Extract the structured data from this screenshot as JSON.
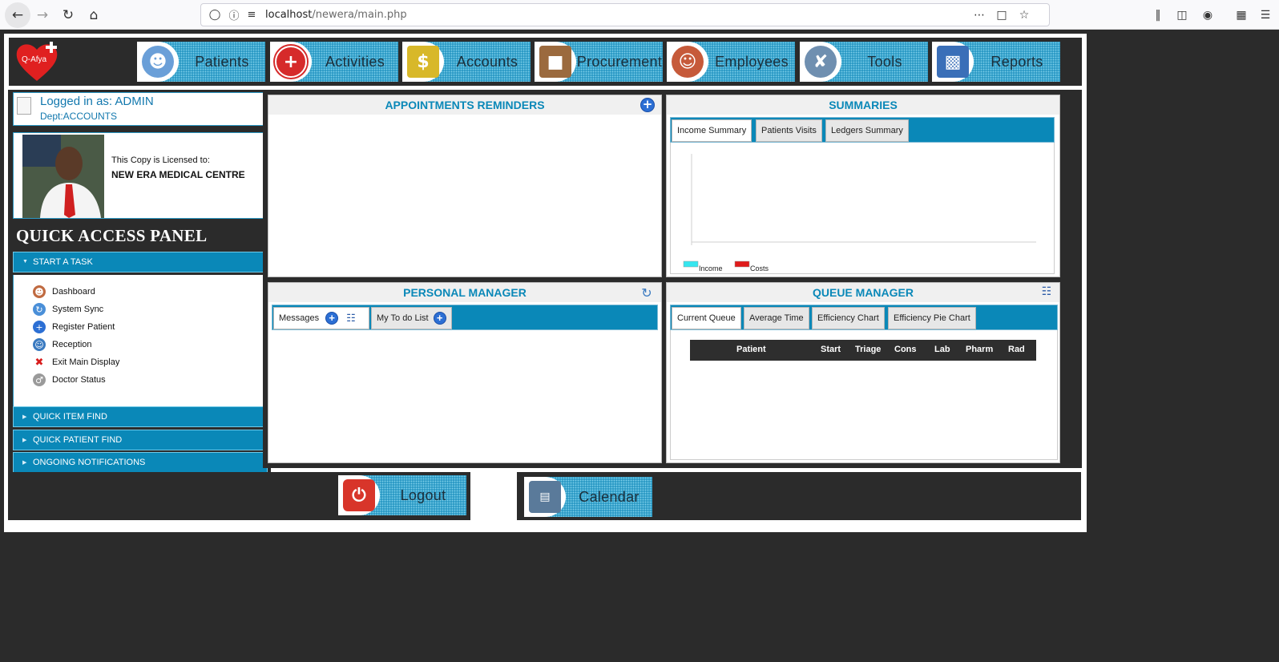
{
  "browser": {
    "url_host": "localhost",
    "url_path": "/newera/main.php"
  },
  "app": {
    "logo_text": "Q-Afya",
    "nav": [
      {
        "label": "Patients",
        "icon": "patient-icon",
        "color": "#6a9fd8"
      },
      {
        "label": "Activities",
        "icon": "red-cross-icon",
        "color": "#d62a2a"
      },
      {
        "label": "Accounts",
        "icon": "money-icon",
        "color": "#d8b829"
      },
      {
        "label": "Procurement",
        "icon": "box-icon",
        "color": "#9b6a3e"
      },
      {
        "label": "Employees",
        "icon": "employees-icon",
        "color": "#c65a3a"
      },
      {
        "label": "Tools",
        "icon": "tools-icon",
        "color": "#6f8fb0"
      },
      {
        "label": "Reports",
        "icon": "reports-icon",
        "color": "#3a6fb8"
      }
    ]
  },
  "sidebar": {
    "login_label": "Logged in as: ADMIN",
    "dept_label": "Dept:ACCOUNTS",
    "license_label": "This Copy is Licensed to:",
    "license_name": "NEW ERA MEDICAL CENTRE",
    "quick_access_title": "QUICK ACCESS PANEL",
    "start_task_label": "START A TASK",
    "tasks": [
      {
        "label": "Dashboard",
        "icon": "doctor-avatar-icon"
      },
      {
        "label": "System Sync",
        "icon": "sync-icon"
      },
      {
        "label": "Register Patient",
        "icon": "plus-circle-icon"
      },
      {
        "label": "Reception",
        "icon": "reception-icon"
      },
      {
        "label": "Exit Main Display",
        "icon": "close-x-icon"
      },
      {
        "label": "Doctor Status",
        "icon": "doctor-icon"
      }
    ],
    "accordion": [
      {
        "label": "QUICK ITEM FIND"
      },
      {
        "label": "QUICK PATIENT FIND"
      },
      {
        "label": "ONGOING NOTIFICATIONS"
      }
    ]
  },
  "appointments": {
    "title": "APPOINTMENTS REMINDERS"
  },
  "summaries": {
    "title": "SUMMARIES",
    "tabs": [
      "Income Summary",
      "Patients Visits",
      "Ledgers Summary"
    ],
    "legend": [
      {
        "label": "Income",
        "color": "#35e6ef"
      },
      {
        "label": "Costs",
        "color": "#e01b1b"
      }
    ]
  },
  "personal_manager": {
    "title": "PERSONAL MANAGER",
    "tabs": [
      "Messages",
      "My To do List"
    ]
  },
  "queue_manager": {
    "title": "QUEUE MANAGER",
    "tabs": [
      "Current Queue",
      "Average Time",
      "Efficiency Chart",
      "Efficiency Pie Chart"
    ],
    "columns": [
      "Patient",
      "Start",
      "Triage",
      "Cons",
      "Lab",
      "Pharm",
      "Rad"
    ]
  },
  "bottom": {
    "logout_label": "Logout",
    "calendar_label": "Calendar"
  }
}
